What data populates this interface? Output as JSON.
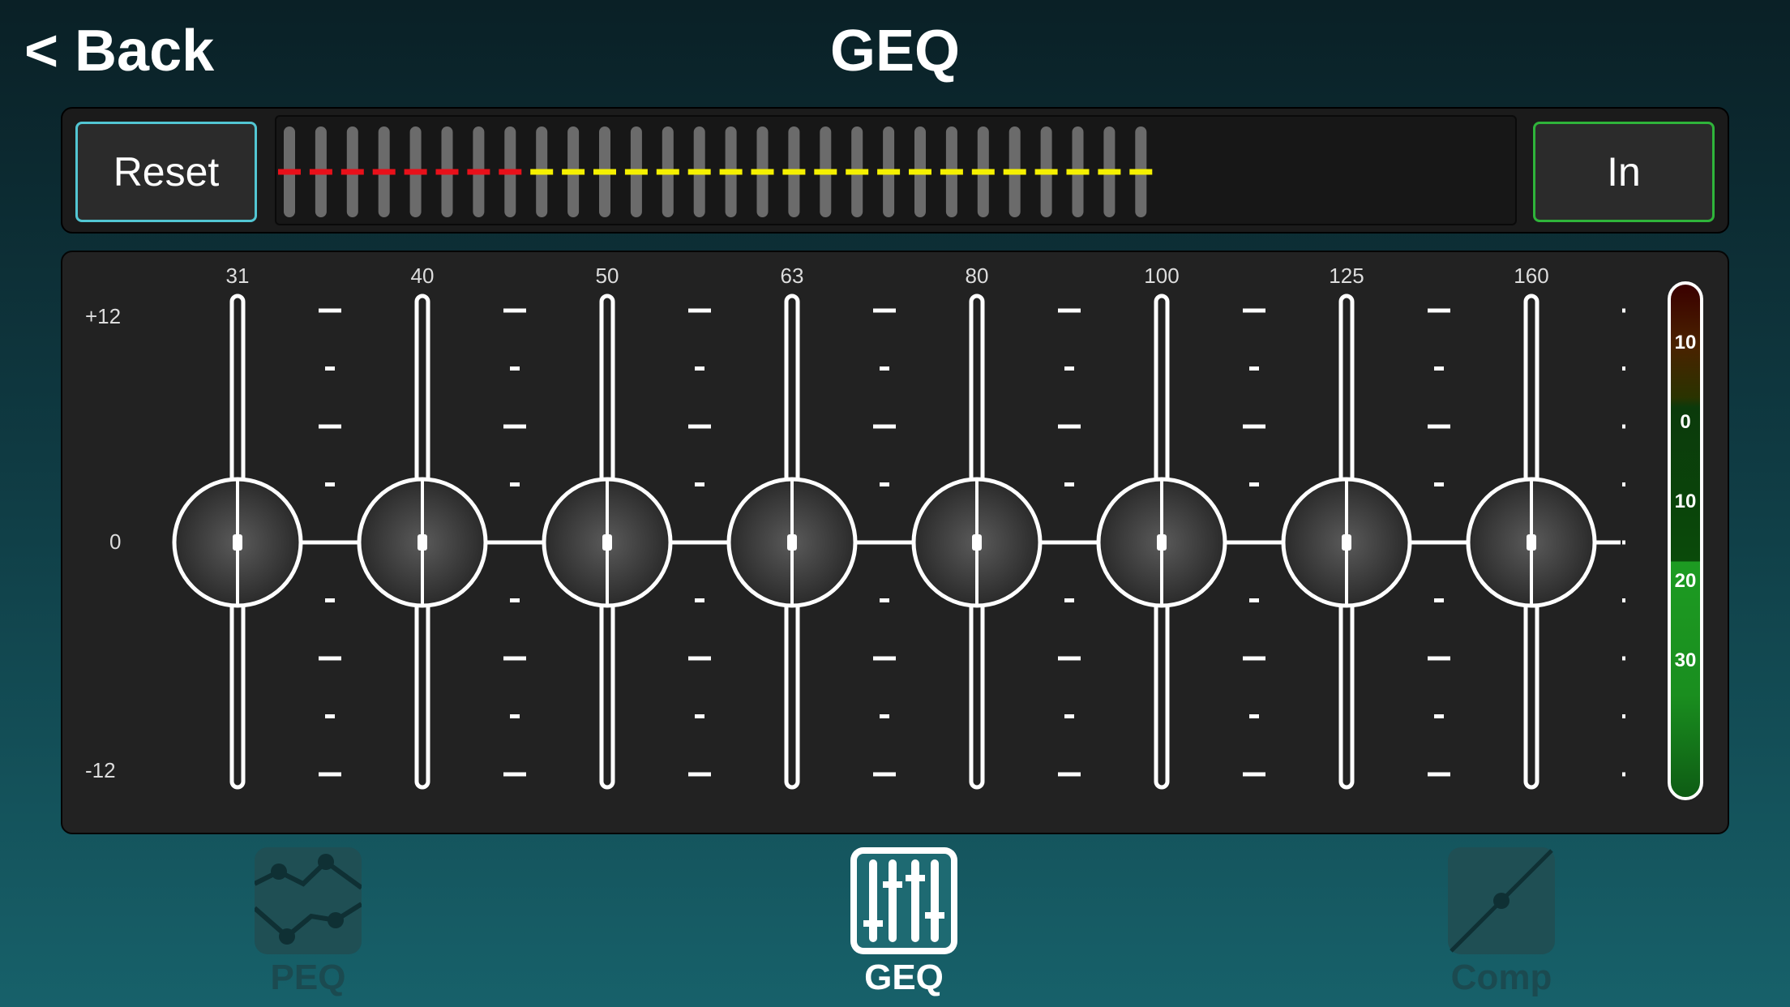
{
  "header": {
    "back_label": "< Back",
    "title": "GEQ"
  },
  "overview": {
    "reset_label": "Reset",
    "in_label": "In",
    "band_count": 28,
    "colors": {
      "low": "#e8101a",
      "high": "#f5f000"
    }
  },
  "geq": {
    "scale": {
      "top": "+12",
      "mid": "0",
      "bottom": "-12"
    },
    "bands": [
      {
        "freq": "31",
        "gain": 0
      },
      {
        "freq": "40",
        "gain": 0
      },
      {
        "freq": "50",
        "gain": 0
      },
      {
        "freq": "63",
        "gain": 0
      },
      {
        "freq": "80",
        "gain": 0
      },
      {
        "freq": "100",
        "gain": 0
      },
      {
        "freq": "125",
        "gain": 0
      },
      {
        "freq": "160",
        "gain": 0
      }
    ]
  },
  "meter": {
    "ticks": [
      "10",
      "0",
      "10",
      "20",
      "30"
    ]
  },
  "tabs": [
    {
      "label": "PEQ",
      "icon": "peq-curve-icon",
      "active": false
    },
    {
      "label": "GEQ",
      "icon": "sliders-icon",
      "active": true
    },
    {
      "label": "Comp",
      "icon": "compressor-curve-icon",
      "active": false
    }
  ]
}
